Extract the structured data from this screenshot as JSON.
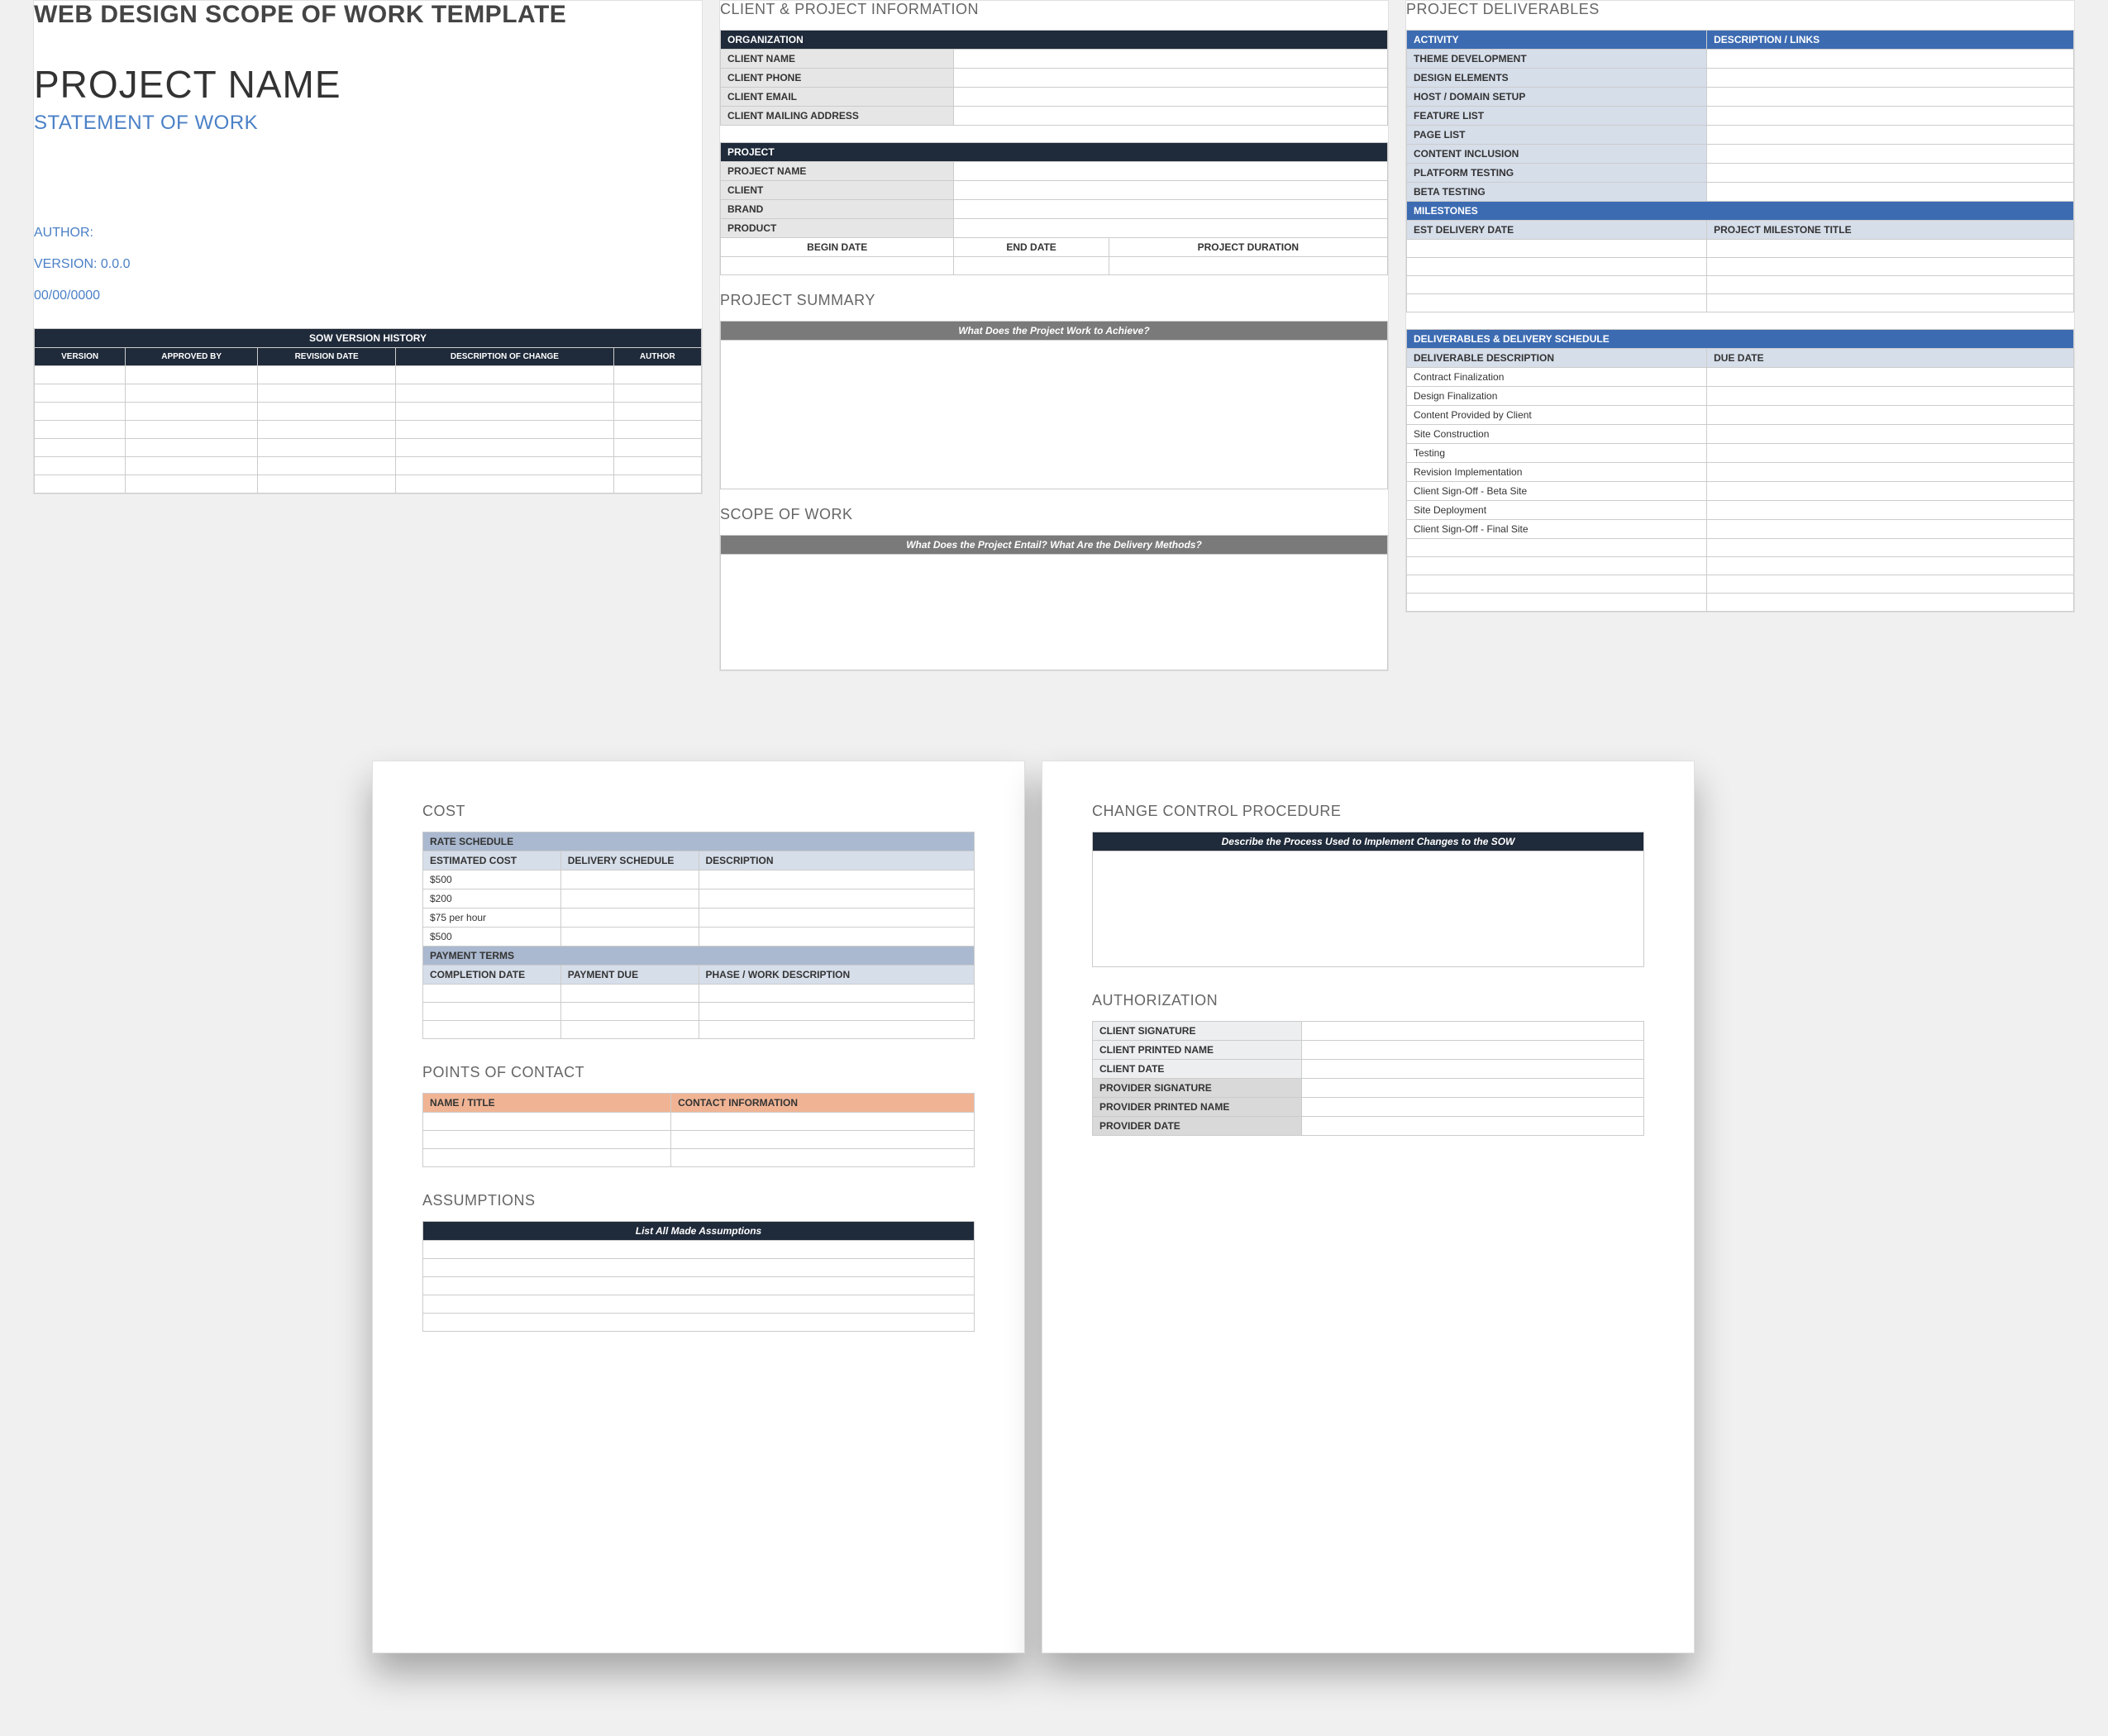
{
  "page1": {
    "template_title": "WEB DESIGN SCOPE OF WORK TEMPLATE",
    "project_name": "PROJECT NAME",
    "subtitle": "STATEMENT OF WORK",
    "author_label": "AUTHOR:",
    "version_label": "VERSION: 0.0.0",
    "date_label": "00/00/0000",
    "history_title": "SOW VERSION HISTORY",
    "history_cols": [
      "VERSION",
      "APPROVED BY",
      "REVISION DATE",
      "DESCRIPTION OF CHANGE",
      "AUTHOR"
    ]
  },
  "page2": {
    "client_section": "CLIENT & PROJECT INFORMATION",
    "org_header": "ORGANIZATION",
    "org_labels": [
      "CLIENT NAME",
      "CLIENT  PHONE",
      "CLIENT EMAIL",
      "CLIENT MAILING ADDRESS"
    ],
    "project_header": "PROJECT",
    "project_labels": [
      "PROJECT NAME",
      "CLIENT",
      "BRAND",
      "PRODUCT"
    ],
    "date_cols": [
      "BEGIN DATE",
      "END DATE",
      "PROJECT DURATION"
    ],
    "summary_title": "PROJECT SUMMARY",
    "summary_hdr": "What Does the Project Work to Achieve?",
    "scope_title": "SCOPE OF WORK",
    "scope_hdr": "What Does the Project Entail? What Are the Delivery Methods?"
  },
  "page3": {
    "deliverables_title": "PROJECT DELIVERABLES",
    "activity_cols": [
      "ACTIVITY",
      "DESCRIPTION / LINKS"
    ],
    "activities": [
      "THEME DEVELOPMENT",
      "DESIGN ELEMENTS",
      "HOST / DOMAIN SETUP",
      "FEATURE LIST",
      "PAGE LIST",
      "CONTENT INCLUSION",
      "PLATFORM TESTING",
      "BETA TESTING"
    ],
    "milestones_hdr": "MILESTONES",
    "milestone_cols": [
      "EST DELIVERY DATE",
      "PROJECT MILESTONE TITLE"
    ],
    "schedule_hdr": "DELIVERABLES & DELIVERY SCHEDULE",
    "schedule_cols": [
      "DELIVERABLE DESCRIPTION",
      "DUE DATE"
    ],
    "schedule_rows": [
      "Contract Finalization",
      "Design Finalization",
      "Content Provided by Client",
      "Site Construction",
      "Testing",
      "Revision Implementation",
      "Client Sign-Off - Beta Site",
      "Site Deployment",
      "Client Sign-Off - Final Site"
    ]
  },
  "page4": {
    "cost_title": "COST",
    "rate_hdr": "RATE SCHEDULE",
    "rate_cols": [
      "ESTIMATED COST",
      "DELIVERY SCHEDULE",
      "DESCRIPTION"
    ],
    "rate_rows": [
      "$500",
      "$200",
      "$75 per hour",
      "$500"
    ],
    "payment_hdr": "PAYMENT TERMS",
    "payment_cols": [
      "COMPLETION DATE",
      "PAYMENT DUE",
      "PHASE / WORK DESCRIPTION"
    ],
    "contacts_title": "POINTS OF CONTACT",
    "contacts_cols": [
      "NAME / TITLE",
      "CONTACT INFORMATION"
    ],
    "assumptions_title": "ASSUMPTIONS",
    "assumptions_hdr": "List All Made Assumptions"
  },
  "page5": {
    "change_title": "CHANGE CONTROL PROCEDURE",
    "change_hdr": "Describe the Process Used to Implement Changes to the SOW",
    "auth_title": "AUTHORIZATION",
    "auth_labels": [
      "CLIENT SIGNATURE",
      "CLIENT PRINTED NAME",
      "CLIENT DATE",
      "PROVIDER SIGNATURE",
      "PROVIDER PRINTED NAME",
      "PROVIDER DATE"
    ]
  }
}
